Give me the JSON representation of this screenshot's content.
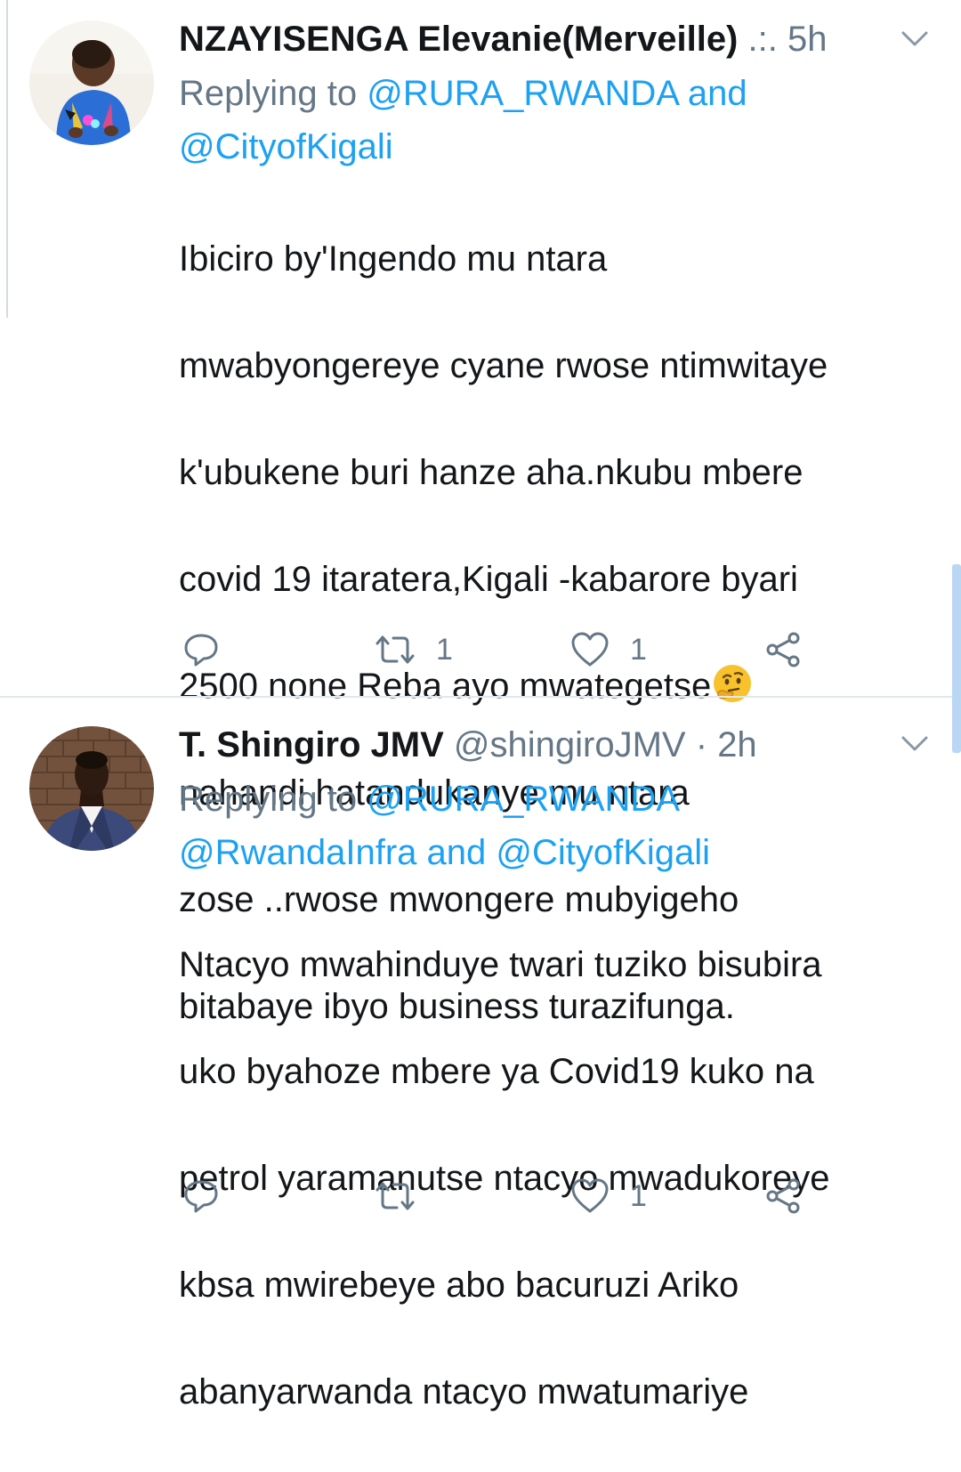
{
  "colors": {
    "link": "#1da1f2",
    "secondary": "#657786",
    "text": "#14171a",
    "divider": "#e1e8ed"
  },
  "tweets": [
    {
      "avatar_icon": "child-avatar",
      "name": "NZAYISENGA Elevanie(Merveille)",
      "handle": ".:.",
      "dot": "",
      "time": "5h",
      "replying_prefix": "Replying to ",
      "replying_line1_mention": "@RURA_RWANDA",
      "replying_line1_sep": " and",
      "replying_line2": "@CityofKigali",
      "replying_line2_sep": "",
      "replying_line2_mention2": "",
      "body_lines": [
        "Ibiciro by'Ingendo mu ntara",
        "mwabyongereye cyane rwose ntimwitaye",
        "k'ubukene buri hanze aha.nkubu mbere",
        "covid 19 itaratera,Kigali -kabarore byari",
        "2500 none Reba ayo mwategetse",
        "nahandi hatandukanye mu ntara",
        "zose ..rwose mwongere mubyigeho",
        "bitabaye ibyo business turazifunga."
      ],
      "emoji_icon": "thinking-face-emoji",
      "replies": "",
      "retweets": "1",
      "likes": "1"
    },
    {
      "avatar_icon": "man-in-suit-avatar",
      "name": "T. Shingiro JMV",
      "handle": "@shingiroJMV",
      "dot": "·",
      "time": "2h",
      "replying_prefix": "Replying to ",
      "replying_line1_mention": "@RURA_RWANDA",
      "replying_line1_sep": "",
      "replying_line2": "@RwandaInfra",
      "replying_line2_sep": " and ",
      "replying_line2_mention2": "@CityofKigali",
      "body_lines": [
        "Ntacyo mwahinduye twari tuziko bisubira",
        "uko byahoze mbere ya Covid19 kuko na",
        "petrol yaramanutse ntacyo mwadukoreye",
        "kbsa mwirebeye abo bacuruzi Ariko",
        "abanyarwanda ntacyo mwatumariye"
      ],
      "replies": "",
      "retweets": "",
      "likes": "1"
    }
  ]
}
